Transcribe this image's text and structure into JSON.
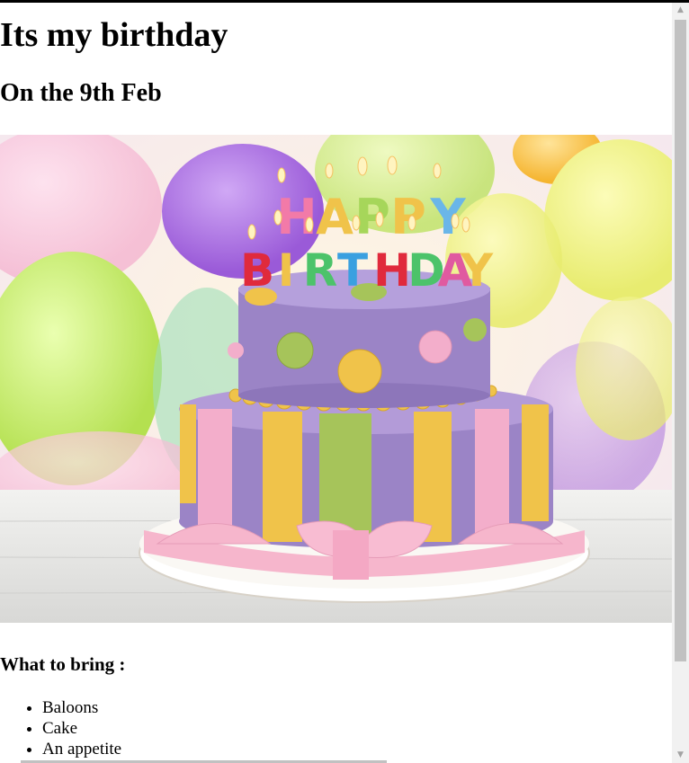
{
  "page": {
    "title": "Its my birthday",
    "subtitle": "On the 9th Feb",
    "hero_image": {
      "alt": "Birthday cake photo",
      "candle_letters": [
        "H",
        "A",
        "P",
        "P",
        "Y",
        "B",
        "I",
        "R",
        "T",
        "H",
        "D",
        "A",
        "Y"
      ]
    },
    "bring_heading": "What to bring :",
    "bring_items": [
      "Baloons",
      "Cake",
      "An appetite"
    ]
  },
  "scrollbar": {
    "up_icon": "▲",
    "down_icon": "▼"
  },
  "colors": {
    "cake_purple": "#9b84c6",
    "stripe_yellow": "#f0c34a",
    "stripe_green": "#a6c45a",
    "stripe_pink": "#f3aecb",
    "ribbon_pink": "#f6b6cc",
    "top_bar": "#000000",
    "scroll_track": "#f1f1f1",
    "scroll_thumb": "#c1c1c1"
  }
}
